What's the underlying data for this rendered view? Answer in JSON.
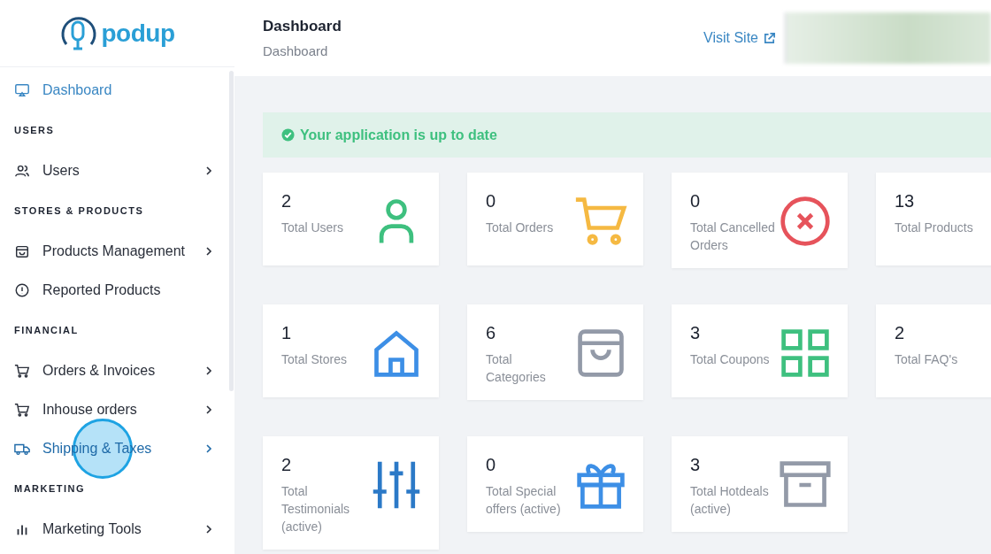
{
  "sidebar": {
    "logo": "podup",
    "sections": [
      {
        "items": [
          {
            "label": "Dashboard",
            "selected": true,
            "hovered": false,
            "expandable": false
          }
        ]
      },
      {
        "heading": "USERS",
        "items": [
          {
            "label": "Users",
            "selected": false,
            "hovered": false,
            "expandable": true
          }
        ]
      },
      {
        "heading": "STORES & PRODUCTS",
        "items": [
          {
            "label": "Products Management",
            "selected": false,
            "hovered": false,
            "expandable": true
          },
          {
            "label": "Reported Products",
            "selected": false,
            "hovered": false,
            "expandable": false
          }
        ]
      },
      {
        "heading": "FINANCIAL",
        "items": [
          {
            "label": "Orders & Invoices",
            "selected": false,
            "hovered": false,
            "expandable": true
          },
          {
            "label": "Inhouse orders",
            "selected": false,
            "hovered": false,
            "expandable": true
          },
          {
            "label": "Shipping & Taxes",
            "selected": false,
            "hovered": true,
            "expandable": true
          }
        ]
      },
      {
        "heading": "MARKETING",
        "items": [
          {
            "label": "Marketing Tools",
            "selected": false,
            "hovered": false,
            "expandable": true
          }
        ]
      }
    ]
  },
  "header": {
    "title": "Dashboard",
    "breadcrumb": "Dashboard",
    "visit_link": "Visit Site"
  },
  "alert": {
    "message": "Your application is up to date"
  },
  "stats": [
    {
      "value": "2",
      "label": "Total Users"
    },
    {
      "value": "0",
      "label": "Total Orders"
    },
    {
      "value": "0",
      "label": "Total Cancelled\nOrders"
    },
    {
      "value": "13",
      "label": "Total Products"
    },
    {
      "value": "1",
      "label": "Total Stores"
    },
    {
      "value": "6",
      "label": "Total\nCategories"
    },
    {
      "value": "3",
      "label": "Total Coupons"
    },
    {
      "value": "2",
      "label": "Total FAQ's"
    },
    {
      "value": "2",
      "label": "Total\nTestimonials\n(active)"
    },
    {
      "value": "0",
      "label": "Total Special\noffers (active)"
    },
    {
      "value": "3",
      "label": "Total Hotdeals\n(active)"
    }
  ]
}
